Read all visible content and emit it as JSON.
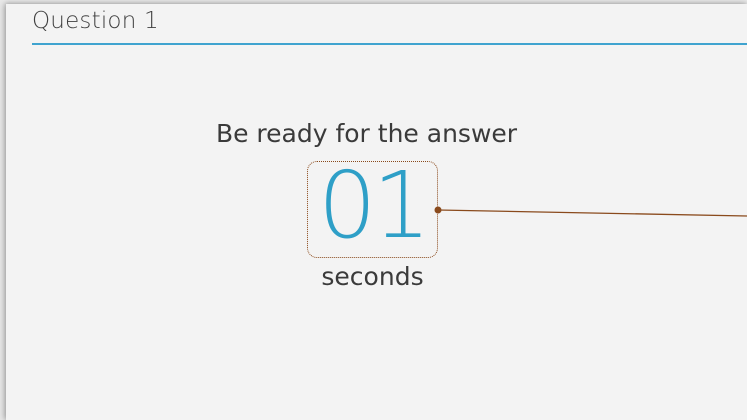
{
  "slide": {
    "title": "Question 1",
    "prompt": "Be ready for the answer",
    "countdown_value": "01",
    "countdown_unit": "seconds"
  },
  "colors": {
    "accent": "#3fa3cf",
    "countdown": "#2e9fc7",
    "callout": "#8a4a1c",
    "background": "#f3f3f3"
  }
}
